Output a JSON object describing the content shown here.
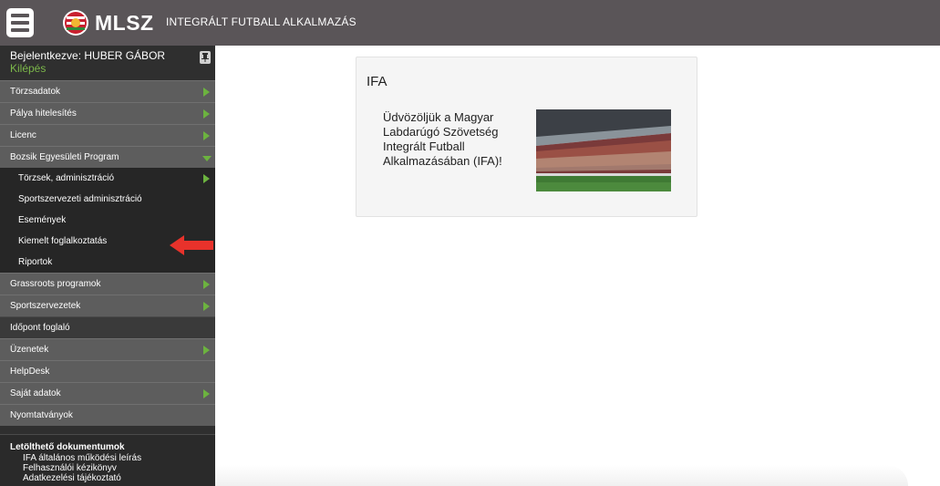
{
  "header": {
    "logo_text": "MLSZ",
    "app_title": "INTEGRÁLT FUTBALL ALKALMAZÁS"
  },
  "user": {
    "logged_in_label": "Bejelentkezve: HUBER GÁBOR",
    "logout_label": "Kilépés"
  },
  "menu": {
    "torzsadatok": "Törzsadatok",
    "palya": "Pálya hitelesítés",
    "licenc": "Licenc",
    "bozsik": "Bozsik Egyesületi Program",
    "bozsik_sub": {
      "torzsek": "Törzsek, adminisztráció",
      "sportszervezeti": "Sportszervezeti adminisztráció",
      "esemenyek": "Események",
      "kiemelt": "Kiemelt foglalkoztatás",
      "riportok": "Riportok"
    },
    "grassroots": "Grassroots programok",
    "sportszervezetek": "Sportszervezetek",
    "idopont": "Időpont foglaló",
    "uzenetek": "Üzenetek",
    "helpdesk": "HelpDesk",
    "sajat": "Saját adatok",
    "nyomtatvanyok": "Nyomtatványok"
  },
  "docs": {
    "title": "Letölthető dokumentumok",
    "items": [
      "IFA általános működési leírás",
      "Felhasználói kézikönyv",
      "Adatkezelési tájékoztató"
    ]
  },
  "card": {
    "title": "IFA",
    "text": "Üdvözöljük a Magyar Labdarúgó Szövetség Integrált Futball Alkalmazásában (IFA)!"
  },
  "colors": {
    "topbar": "#5a5558",
    "sidebar": "#2f2f2f",
    "accent_green": "#6cb33f",
    "highlight_red": "#e8322b"
  }
}
